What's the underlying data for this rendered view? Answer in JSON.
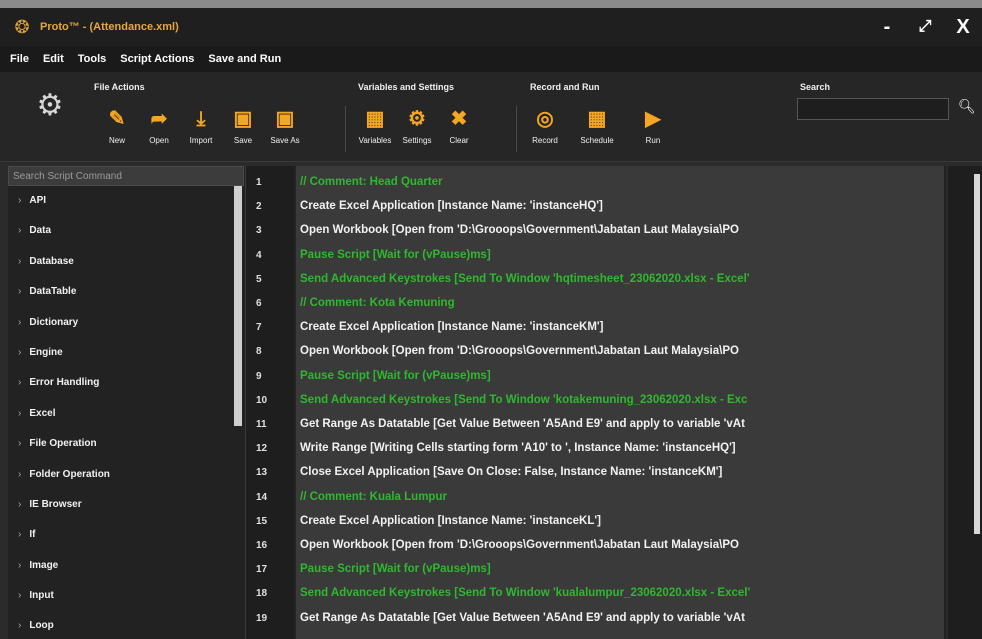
{
  "window": {
    "title": "Proto™ - (Attendance.xml)",
    "controls": {
      "minimize": "-",
      "maximize": "⤢",
      "close": "X"
    }
  },
  "menu": [
    "File",
    "Edit",
    "Tools",
    "Script Actions",
    "Save and Run"
  ],
  "ribbon": {
    "file_actions": {
      "title": "File Actions",
      "tools": [
        {
          "label": "New",
          "icon": "new-icon"
        },
        {
          "label": "Open",
          "icon": "open-icon"
        },
        {
          "label": "Import",
          "icon": "import-icon"
        },
        {
          "label": "Save",
          "icon": "save-icon"
        },
        {
          "label": "Save As",
          "icon": "save-as-icon"
        }
      ]
    },
    "variables_settings": {
      "title": "Variables and Settings",
      "tools": [
        {
          "label": "Variables",
          "icon": "variables-icon"
        },
        {
          "label": "Settings",
          "icon": "gear-icon"
        },
        {
          "label": "Clear",
          "icon": "clear-icon"
        }
      ]
    },
    "record_run": {
      "title": "Record and Run",
      "tools": [
        {
          "label": "Record",
          "icon": "record-icon"
        },
        {
          "label": "Schedule",
          "icon": "schedule-icon"
        },
        {
          "label": "Run",
          "icon": "play-icon"
        }
      ]
    },
    "search": {
      "title": "Search",
      "value": ""
    }
  },
  "sidebar": {
    "search_placeholder": "Search Script Command",
    "items": [
      "API",
      "Data",
      "Database",
      "DataTable",
      "Dictionary",
      "Engine",
      "Error Handling",
      "Excel",
      "File Operation",
      "Folder Operation",
      "IE Browser",
      "If",
      "Image",
      "Input",
      "Loop"
    ]
  },
  "editor": {
    "lines": [
      {
        "n": "1",
        "text": "// Comment: Head Quarter",
        "color": "green"
      },
      {
        "n": "2",
        "text": "Create Excel Application [Instance Name: 'instanceHQ']",
        "color": "default"
      },
      {
        "n": "3",
        "text": "Open Workbook [Open from 'D:\\Grooops\\Government\\Jabatan Laut Malaysia\\PO",
        "color": "default"
      },
      {
        "n": "4",
        "text": "Pause Script [Wait for (vPause)ms]",
        "color": "green"
      },
      {
        "n": "5",
        "text": "Send Advanced Keystrokes [Send To Window 'hqtimesheet_23062020.xlsx - Excel'",
        "color": "green"
      },
      {
        "n": "6",
        "text": "// Comment: Kota Kemuning",
        "color": "green"
      },
      {
        "n": "7",
        "text": "Create Excel Application [Instance Name: 'instanceKM']",
        "color": "default"
      },
      {
        "n": "8",
        "text": "Open Workbook [Open from 'D:\\Grooops\\Government\\Jabatan Laut Malaysia\\PO",
        "color": "default"
      },
      {
        "n": "9",
        "text": "Pause Script [Wait for (vPause)ms]",
        "color": "green"
      },
      {
        "n": "10",
        "text": "Send Advanced Keystrokes [Send To Window 'kotakemuning_23062020.xlsx - Exc",
        "color": "green"
      },
      {
        "n": "11",
        "text": "Get Range As Datatable [Get Value Between 'A5And E9' and apply to variable 'vAt",
        "color": "default"
      },
      {
        "n": "12",
        "text": "Write Range [Writing Cells starting form 'A10' to ', Instance Name: 'instanceHQ']",
        "color": "default"
      },
      {
        "n": "13",
        "text": "Close Excel Application [Save On Close: False, Instance Name: 'instanceKM']",
        "color": "default"
      },
      {
        "n": "14",
        "text": "// Comment: Kuala Lumpur",
        "color": "green"
      },
      {
        "n": "15",
        "text": "Create Excel Application [Instance Name: 'instanceKL']",
        "color": "default"
      },
      {
        "n": "16",
        "text": "Open Workbook [Open from 'D:\\Grooops\\Government\\Jabatan Laut Malaysia\\PO",
        "color": "default"
      },
      {
        "n": "17",
        "text": "Pause Script [Wait for (vPause)ms]",
        "color": "green"
      },
      {
        "n": "18",
        "text": "Send Advanced Keystrokes [Send To Window 'kualalumpur_23062020.xlsx - Excel'",
        "color": "green"
      },
      {
        "n": "19",
        "text": "Get Range As Datatable [Get Value Between 'A5And E9' and apply to variable 'vAt",
        "color": "default"
      }
    ]
  }
}
